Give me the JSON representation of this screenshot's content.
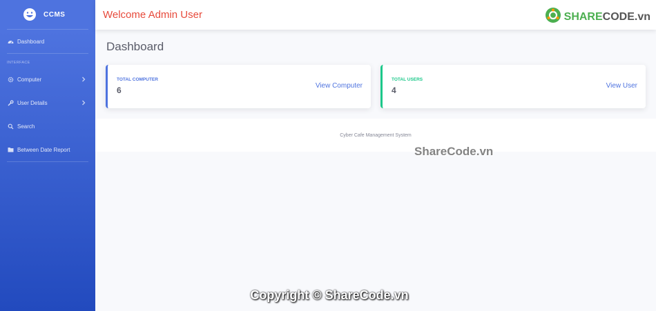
{
  "sidebar": {
    "brand": "CCMS",
    "items": [
      {
        "label": "Dashboard",
        "icon": "dashboard-icon"
      },
      {
        "label": "Computer",
        "icon": "gear-icon",
        "expandable": true
      },
      {
        "label": "User Details",
        "icon": "wrench-icon",
        "expandable": true
      },
      {
        "label": "Search",
        "icon": "search-icon"
      },
      {
        "label": "Between Date Report",
        "icon": "folder-icon"
      }
    ],
    "section_heading": "INTERFACE"
  },
  "topbar": {
    "welcome": "Welcome  Admin User",
    "logo_part1": "SHARE",
    "logo_part2": "CODE.vn"
  },
  "main": {
    "title": "Dashboard",
    "cards": [
      {
        "label": "TOTAL COMPUTER",
        "value": "6",
        "link": "View Computer",
        "accent": "#4e73df"
      },
      {
        "label": "TOTAL USERS",
        "value": "4",
        "link": "View User",
        "accent": "#1cc88a"
      }
    ]
  },
  "footer": {
    "text": "Cyber Cafe Management System"
  },
  "watermarks": {
    "middle": "ShareCode.vn",
    "bottom": "Copyright © ShareCode.vn"
  },
  "colors": {
    "sidebar_top": "#4e73df",
    "sidebar_bottom": "#224abe",
    "welcome": "#e74a3b",
    "background": "#f8f9fc"
  }
}
